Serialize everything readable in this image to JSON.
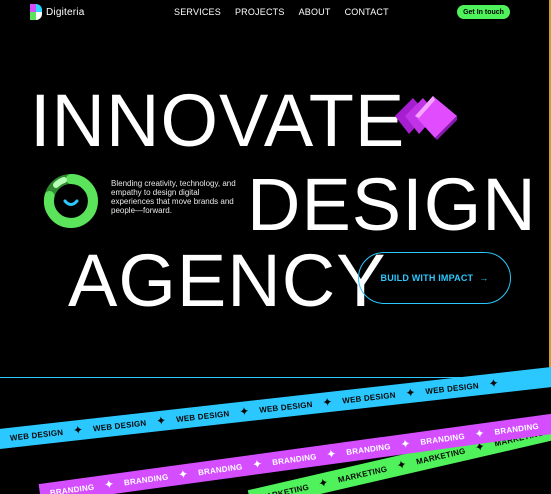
{
  "brand": {
    "name": "Digiteria"
  },
  "nav": {
    "links": [
      "SERVICES",
      "PROJECTS",
      "ABOUT",
      "CONTACT"
    ],
    "cta_label": "Get In touch"
  },
  "hero": {
    "line1": "INNOVATE",
    "line2": "DESIGN",
    "line3": "AGENCY",
    "blurb": "Blending creativity, technology, and empathy to design digital experiences that move brands and people—forward.",
    "cta_label": "BUILD WITH IMPACT",
    "cta_arrow": "→"
  },
  "ribbons": {
    "blue_word": "WEB DESIGN",
    "pink_word": "BRANDING",
    "green_word": "MARKETING",
    "separator_icon": "sparkle-icon"
  },
  "colors": {
    "background": "#000000",
    "accent_green": "#4ff25a",
    "accent_blue": "#2bc8ff",
    "accent_pink": "#d44dff"
  }
}
